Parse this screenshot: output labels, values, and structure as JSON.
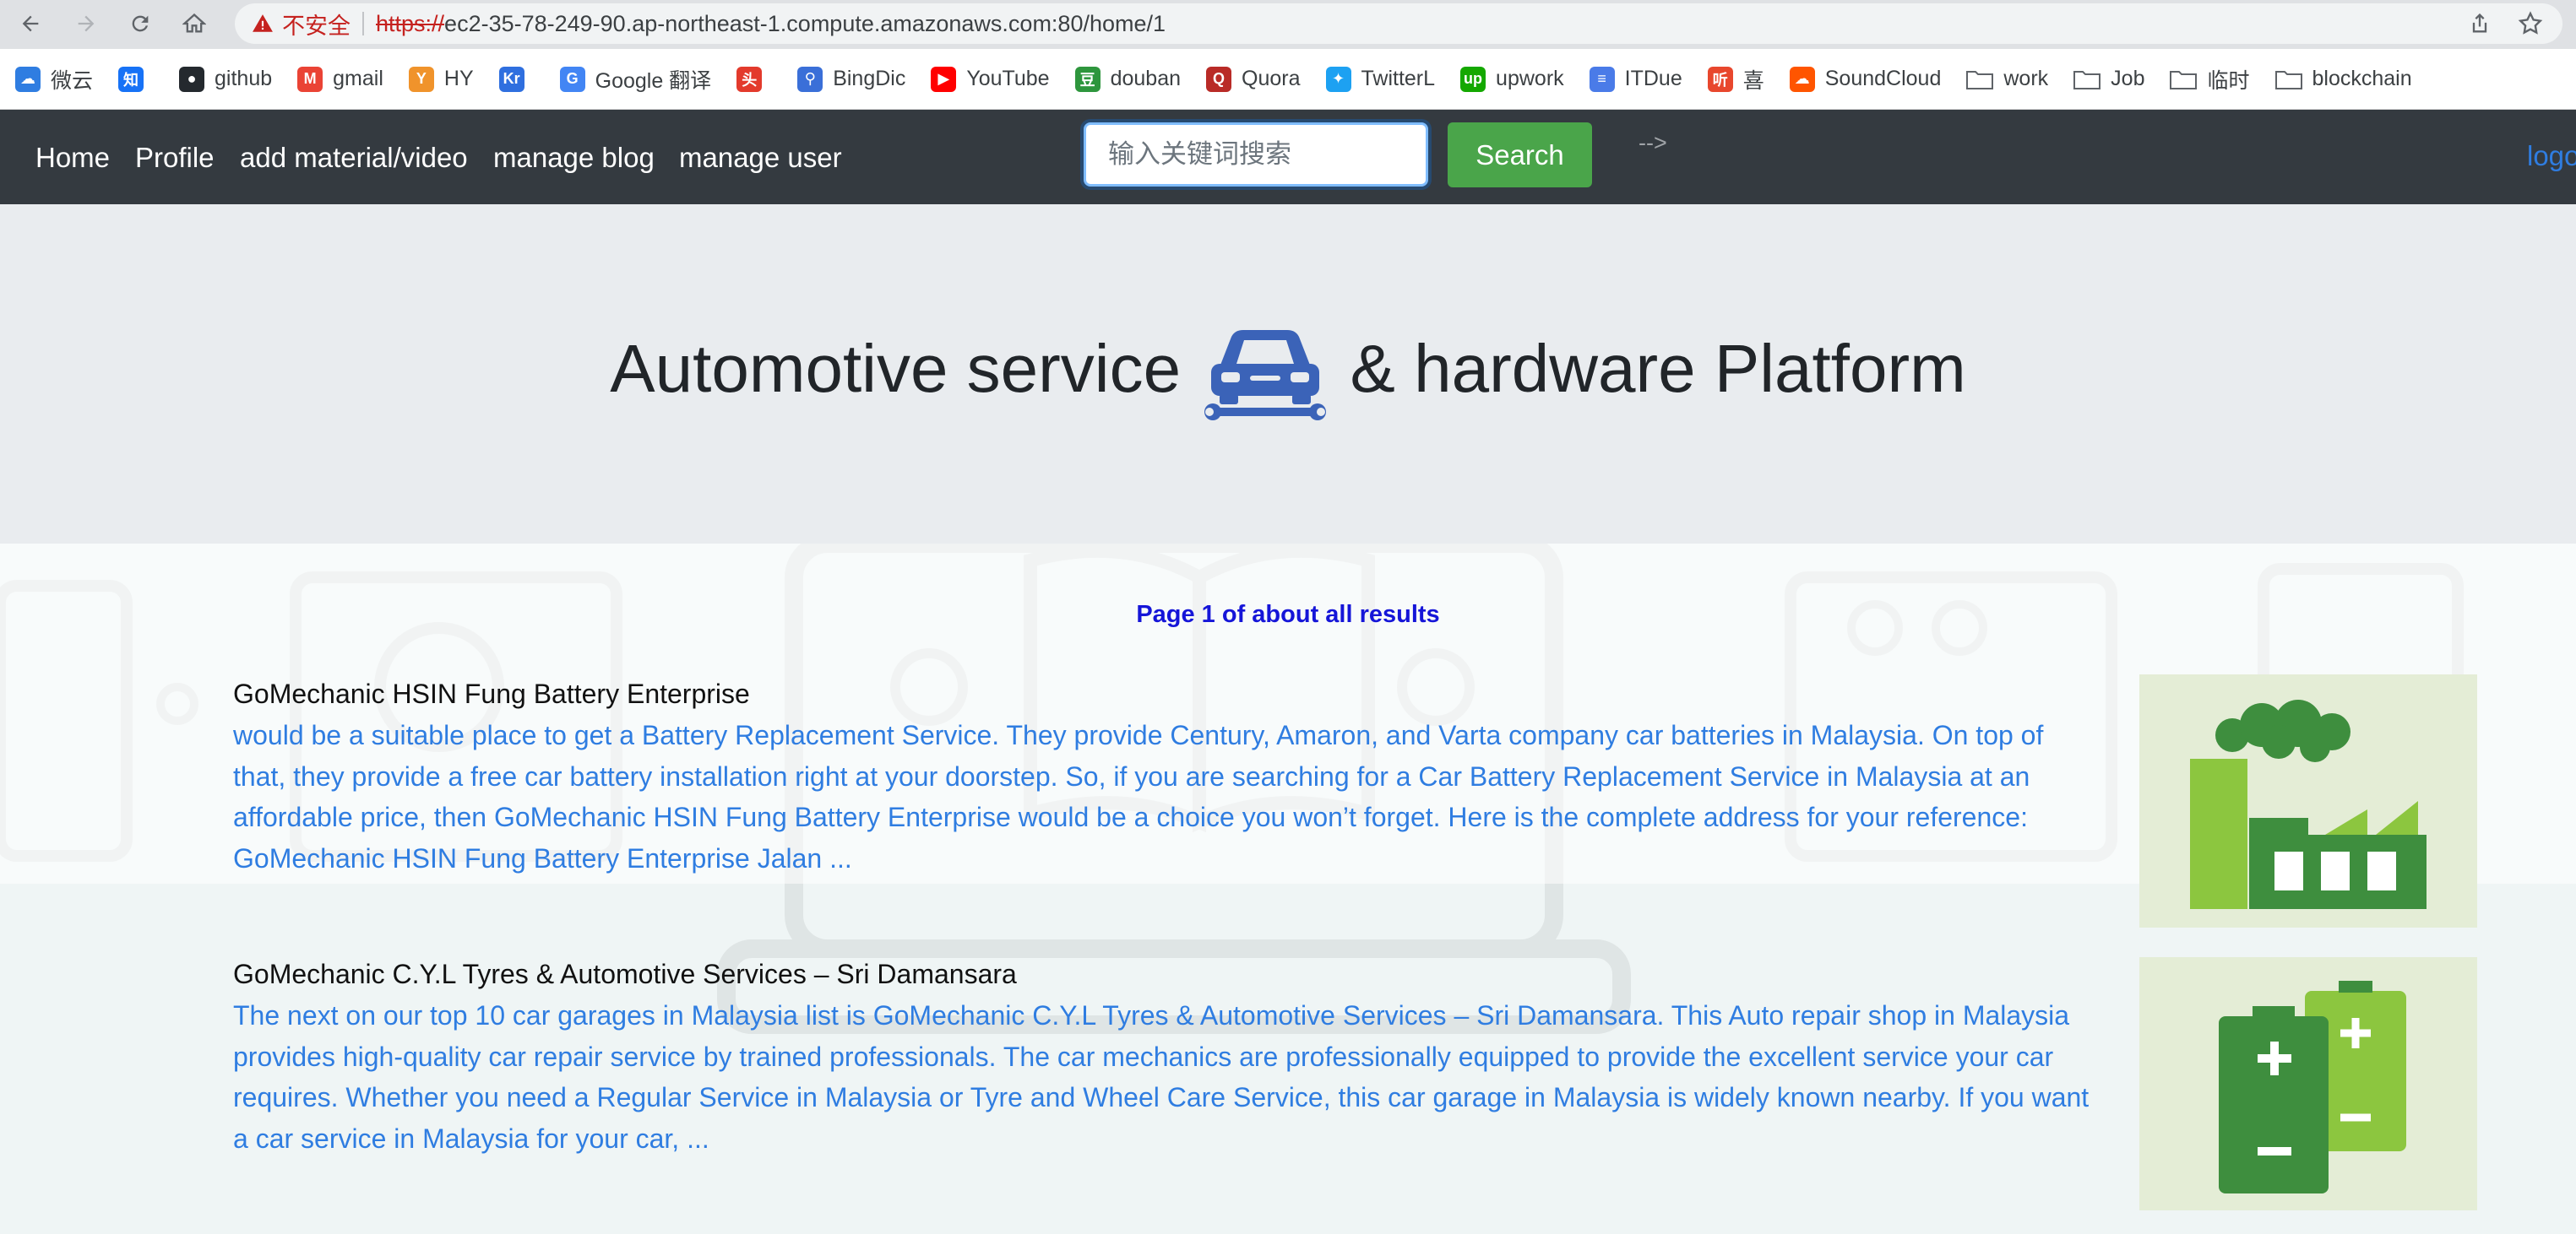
{
  "browser": {
    "security_warning": "不安全",
    "url_scheme": "https://",
    "url_rest": "ec2-35-78-249-90.ap-northeast-1.compute.amazonaws.com:80/home/1",
    "bookmarks": [
      {
        "label": "微云",
        "icon": "weiyun-icon",
        "color": "#2f7de1",
        "glyph": "☁"
      },
      {
        "label": "",
        "icon": "zhihu-icon",
        "color": "#1772f6",
        "glyph": "知"
      },
      {
        "label": "github",
        "icon": "github-icon",
        "color": "#24292e",
        "glyph": "●"
      },
      {
        "label": "gmail",
        "icon": "gmail-icon",
        "color": "#ea4335",
        "glyph": "M"
      },
      {
        "label": "HY",
        "icon": "hy-icon",
        "color": "#f0932b",
        "glyph": "Y"
      },
      {
        "label": "",
        "icon": "kr-icon",
        "color": "#2f6fdf",
        "glyph": "Kr"
      },
      {
        "label": "Google 翻译",
        "icon": "google-translate-icon",
        "color": "#4285f4",
        "glyph": "G"
      },
      {
        "label": "",
        "icon": "toutiao-icon",
        "color": "#e33a2c",
        "glyph": "头"
      },
      {
        "label": "BingDic",
        "icon": "bing-search-icon",
        "color": "#3a6fd8",
        "glyph": "⚲"
      },
      {
        "label": "YouTube",
        "icon": "youtube-icon",
        "color": "#ff0000",
        "glyph": "▶"
      },
      {
        "label": "douban",
        "icon": "douban-icon",
        "color": "#2e963d",
        "glyph": "豆"
      },
      {
        "label": "Quora",
        "icon": "quora-icon",
        "color": "#b92b27",
        "glyph": "Q"
      },
      {
        "label": "TwitterL",
        "icon": "twitter-icon",
        "color": "#1da1f2",
        "glyph": "✦"
      },
      {
        "label": "upwork",
        "icon": "upwork-icon",
        "color": "#14a800",
        "glyph": "up"
      },
      {
        "label": "ITDue",
        "icon": "doc-icon",
        "color": "#4a7be8",
        "glyph": "≡"
      },
      {
        "label": "喜",
        "icon": "ximalaya-icon",
        "color": "#e8472d",
        "glyph": "听"
      },
      {
        "label": "SoundCloud",
        "icon": "soundcloud-icon",
        "color": "#ff5500",
        "glyph": "☁"
      },
      {
        "label": "work",
        "icon": "folder-icon",
        "folder": true
      },
      {
        "label": "Job",
        "icon": "folder-icon",
        "folder": true
      },
      {
        "label": "临时",
        "icon": "folder-icon",
        "folder": true
      },
      {
        "label": "blockchain",
        "icon": "folder-icon",
        "folder": true
      }
    ]
  },
  "navbar": {
    "links": [
      "Home",
      "Profile",
      "add material/video",
      "manage blog",
      "manage user"
    ],
    "search_placeholder": "输入关键词搜索",
    "search_button": "Search",
    "stray_text": "-->",
    "logout": "logo"
  },
  "hero": {
    "title_part1": "Automotive service",
    "title_part2": "& hardware Platform"
  },
  "results": {
    "page_info": "Page 1 of about all results",
    "items": [
      {
        "title": "GoMechanic HSIN Fung Battery Enterprise",
        "body": "would be a suitable place to get a Battery Replacement Service. They provide Century, Amaron, and Varta company car batteries in Malaysia. On top of that, they provide a free car battery installation right at your doorstep. So, if you are searching for a Car Battery Replacement Service in Malaysia at an affordable price, then GoMechanic HSIN Fung Battery Enterprise would be a choice you won’t forget. Here is the complete address for your reference: GoMechanic HSIN Fung Battery Enterprise Jalan ...",
        "thumb": "factory-icon"
      },
      {
        "title": "GoMechanic C.Y.L Tyres & Automotive Services – Sri Damansara",
        "body": "The next on our top 10 car garages in Malaysia list is GoMechanic C.Y.L Tyres & Automotive Services – Sri Damansara. This Auto repair shop in Malaysia provides high-quality car repair service by trained professionals. The car mechanics are professionally equipped to provide the excellent service your car requires. Whether you need a Regular Service in Malaysia or Tyre and Wheel Care Service, this car garage in Malaysia is widely known nearby. If you want a car service in Malaysia for your car, ...",
        "thumb": "battery-icon"
      }
    ]
  }
}
